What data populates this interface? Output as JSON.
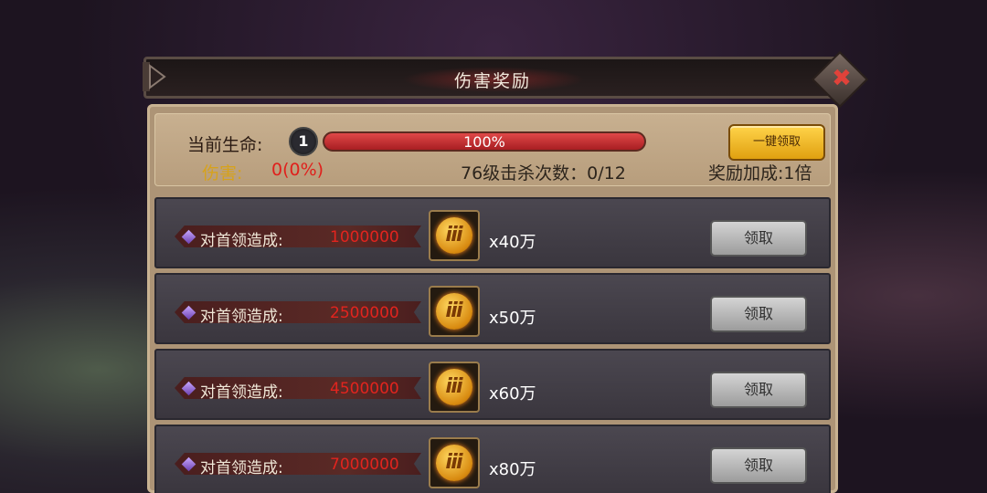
{
  "dialog": {
    "title": "伤害奖励",
    "close_icon": "close-x",
    "back_icon": "back-arrow"
  },
  "status": {
    "life_label": "当前生命:",
    "level": "1",
    "hp_percent": 1.0,
    "hp_text": "100%",
    "damage_label": "伤害:",
    "damage_value": "0(0%)",
    "kills_text": "76级击杀次数：0/12",
    "bonus_text": "奖励加成:1倍",
    "claim_all_label": "一键领取"
  },
  "rewards": [
    {
      "label": "对首领造成:",
      "value": "1000000",
      "qty": "x40万",
      "button": "领取"
    },
    {
      "label": "对首领造成:",
      "value": "2500000",
      "qty": "x50万",
      "button": "领取"
    },
    {
      "label": "对首领造成:",
      "value": "4500000",
      "qty": "x60万",
      "button": "领取"
    },
    {
      "label": "对首领造成:",
      "value": "7000000",
      "qty": "x80万",
      "button": "领取"
    }
  ],
  "colors": {
    "damage_red": "#e2241e",
    "gold_button": "#e0a010"
  }
}
